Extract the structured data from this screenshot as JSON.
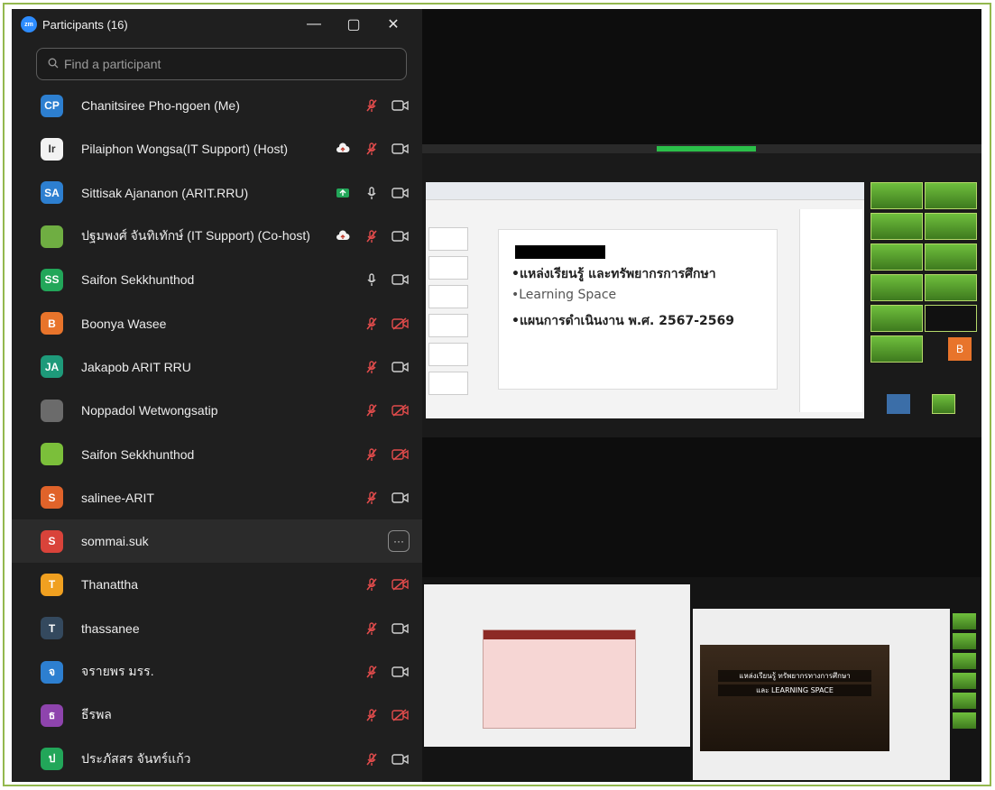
{
  "window": {
    "title": "Participants (16)",
    "logo_text": "zm",
    "minimize": "—",
    "maximize": "▢",
    "close": "✕"
  },
  "search": {
    "placeholder": "Find a participant"
  },
  "participants": [
    {
      "initials": "CP",
      "color": "#2d7fd0",
      "name": "Chanitsiree Pho-ngoen (Me)",
      "share": "",
      "mic": "muted",
      "video": "off"
    },
    {
      "initials": "Ir",
      "color": "#f2f2f2",
      "name": "Pilaiphon Wongsa(IT Support) (Host)",
      "share": "cloud",
      "mic": "muted",
      "video": "off"
    },
    {
      "initials": "SA",
      "color": "#2d7fd0",
      "name": "Sittisak Ajananon (ARIT.RRU)",
      "share": "screen",
      "mic": "on",
      "video": "off"
    },
    {
      "initials": "",
      "color": "#6fae42",
      "name": "ปฐมพงศ์ จันทิเทักษ์ (IT Support) (Co-host)",
      "share": "cloud",
      "mic": "muted",
      "video": "off"
    },
    {
      "initials": "SS",
      "color": "#22a659",
      "name": "Saifon Sekkhunthod",
      "share": "",
      "mic": "on",
      "video": "off"
    },
    {
      "initials": "B",
      "color": "#e8742b",
      "name": "Boonya Wasee",
      "share": "",
      "mic": "muted",
      "video": "off-red"
    },
    {
      "initials": "JA",
      "color": "#1e9a7a",
      "name": "Jakapob ARIT RRU",
      "share": "",
      "mic": "muted",
      "video": "off"
    },
    {
      "initials": "",
      "color": "#6b6b6b",
      "name": "Noppadol Wetwongsatip",
      "share": "",
      "mic": "muted",
      "video": "off-red"
    },
    {
      "initials": "",
      "color": "#7bbf3a",
      "name": "Saifon Sekkhunthod",
      "share": "",
      "mic": "muted",
      "video": "off-red"
    },
    {
      "initials": "S",
      "color": "#e0632a",
      "name": "salinee-ARIT",
      "share": "",
      "mic": "muted",
      "video": "off"
    },
    {
      "initials": "S",
      "color": "#d9433a",
      "name": "sommai.suk",
      "share": "",
      "mic": "",
      "video": "",
      "more": "···"
    },
    {
      "initials": "T",
      "color": "#f0a020",
      "name": "Thanattha",
      "share": "",
      "mic": "muted",
      "video": "off-red"
    },
    {
      "initials": "T",
      "color": "#34495e",
      "name": "thassanee",
      "share": "",
      "mic": "muted",
      "video": "off"
    },
    {
      "initials": "จ",
      "color": "#2d7fd0",
      "name": "จรายพร มรร.",
      "share": "",
      "mic": "muted",
      "video": "off"
    },
    {
      "initials": "ธ",
      "color": "#8e44ad",
      "name": "ธีรพล",
      "share": "",
      "mic": "muted",
      "video": "off-red"
    },
    {
      "initials": "ป",
      "color": "#22a659",
      "name": "ประภัสสร จันทร์แก้ว",
      "share": "",
      "mic": "muted",
      "video": "off"
    }
  ],
  "slide": {
    "line1": "•แหล่งเรียนรู้ และทรัพยากรการศึกษา",
    "line2": "•Learning Space",
    "line3": "•แผนการดำเนินงาน พ.ศ. 2567-2569"
  },
  "gallery_tile_label": "B",
  "video": {
    "caption1": "แหล่งเรียนรู้ ทรัพยากรทางการศึกษา",
    "caption2": "และ LEARNING SPACE"
  }
}
